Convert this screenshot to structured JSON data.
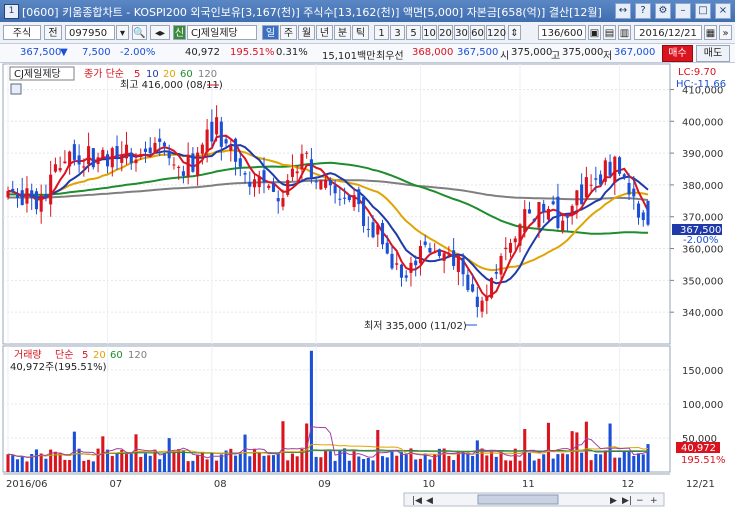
{
  "title_bar": {
    "app_code": "1",
    "title": "[0600] 키움종합차트 - KOSPI200 외국인보유[3,167(천)] 주식수[13,162(천)] 액면[5,000] 자본금[658(억)] 결산[12월]"
  },
  "toolbar": {
    "market": "주식",
    "prev_label": "전",
    "stock_code": "097950",
    "shin_label": "신",
    "stock_name": "CJ제일제당",
    "period_buttons": [
      "일",
      "주",
      "월",
      "년",
      "분",
      "틱"
    ],
    "interval_buttons": [
      "1",
      "3",
      "5",
      "10",
      "20",
      "30",
      "60",
      "120"
    ],
    "data_count": "136/600",
    "date": "2016/12/21"
  },
  "quote": {
    "price": "367,500",
    "direction": "▼",
    "change": "7,500",
    "change_pct": "-2.00%",
    "volume": "40,972",
    "volume_ratio": "195.51%",
    "turnover": "0.31%",
    "trade_value": "15,101백만",
    "bid_label": "최우선",
    "best_ask": "368,000",
    "best_bid": "367,500",
    "open_label": "시",
    "open": "375,000",
    "high_label": "고",
    "high": "375,000",
    "low_label": "저",
    "low": "367,000",
    "buy_button": "매수",
    "sell_button": "매도"
  },
  "colors": {
    "up": "#d9141f",
    "down": "#1a4fd6",
    "ma5": "#d9141f",
    "ma10": "#1f3aa8",
    "ma20": "#e0a400",
    "ma60": "#1f8c2e",
    "ma120": "#7f7f7f"
  },
  "chart_data": [
    {
      "type": "candlestick",
      "title_tag": "CJ제일제당",
      "legend": {
        "label": "종가 단순",
        "periods": [
          "5",
          "10",
          "20",
          "60",
          "120"
        ]
      },
      "lc_label": "LC:9.70",
      "hc_label": "HC:-11.66",
      "y_axis_ticks": [
        "410,000",
        "400,000",
        "390,000",
        "380,000",
        "370,000",
        "360,000",
        "350,000",
        "340,000"
      ],
      "ylim": [
        330000,
        418000
      ],
      "annotations": {
        "high": "최고 416,000 (08/11)",
        "low": "최저 335,000 (11/02)"
      },
      "current_price_label": "367,500",
      "current_change_label": "-2.00%",
      "x_ticks": [
        "2016/06",
        "07",
        "08",
        "09",
        "10",
        "11",
        "12",
        "12/21"
      ],
      "n_bars": 136,
      "keypoints": {
        "index": [
          0,
          6,
          12,
          22,
          30,
          37,
          44,
          50,
          57,
          62,
          68,
          75,
          80,
          84,
          88,
          94,
          100,
          104,
          108,
          112,
          116,
          120,
          124,
          128,
          131,
          135
        ],
        "close": [
          382000,
          372000,
          388000,
          389000,
          392000,
          384000,
          398000,
          384000,
          377000,
          388000,
          380000,
          370000,
          360000,
          349000,
          362000,
          357000,
          343000,
          355000,
          368000,
          372000,
          370000,
          375000,
          382000,
          388000,
          377000,
          367500
        ]
      },
      "ma_start_values": {
        "ma60": 377000,
        "ma120": 376000
      }
    },
    {
      "type": "bar",
      "title": "거래량",
      "legend": {
        "label": "단순",
        "periods": [
          "5",
          "20",
          "60",
          "120"
        ]
      },
      "current_label": "40,972주(195.51%)",
      "y_axis_ticks": [
        "150,000",
        "100,000",
        "50,000"
      ],
      "ylim": [
        0,
        185000
      ],
      "current_volume_label": "40,972",
      "current_pct_label": "195.51%",
      "peak_volume": 178000
    }
  ]
}
